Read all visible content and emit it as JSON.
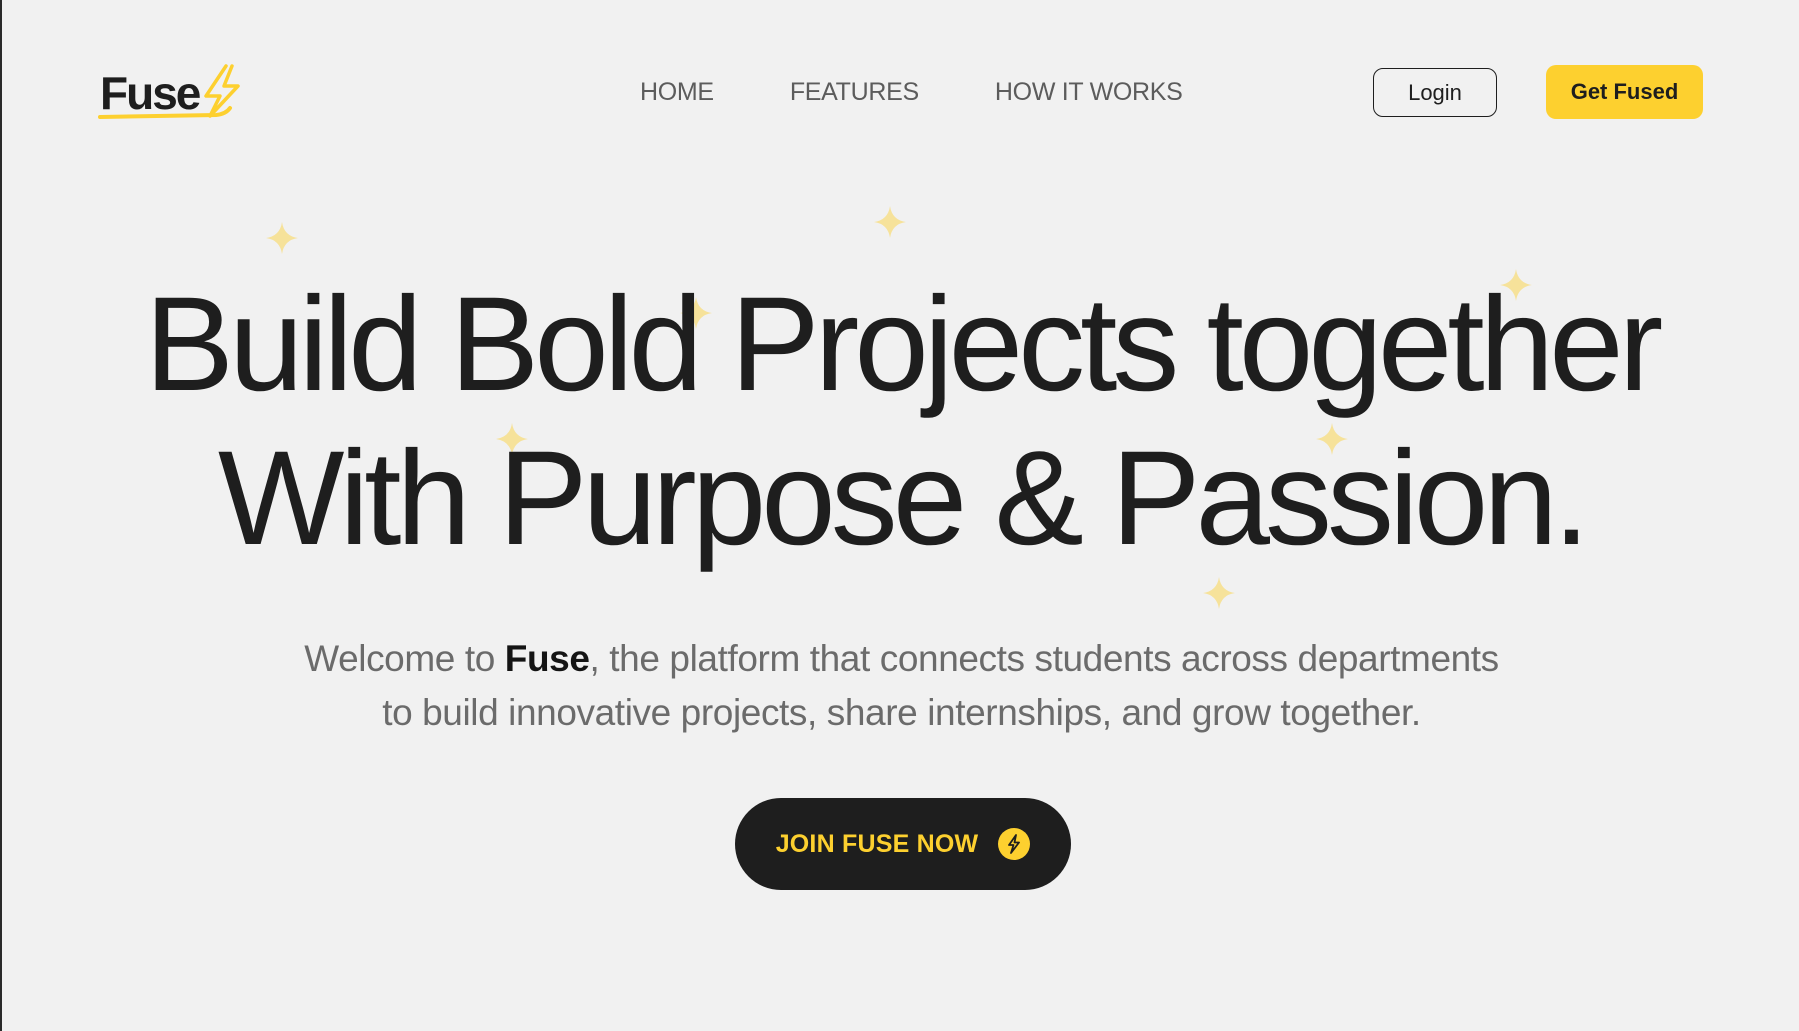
{
  "brand": {
    "name": "Fuse",
    "accent_color": "#fdd02f",
    "logo_icon": "lightning-bolt-icon"
  },
  "nav": {
    "links": [
      {
        "label": "HOME"
      },
      {
        "label": "FEATURES"
      },
      {
        "label": "HOW IT WORKS"
      }
    ],
    "login_label": "Login",
    "get_fused_label": "Get Fused"
  },
  "hero": {
    "headline_line1": "Build Bold Projects together",
    "headline_line2": "With Purpose & Passion.",
    "subtitle_prefix": "Welcome to ",
    "subtitle_brand": "Fuse",
    "subtitle_line1_rest": ", the platform that connects students across departments",
    "subtitle_line2": "to build innovative projects, share internships, and grow together.",
    "cta_label": "JOIN FUSE NOW",
    "cta_icon": "lightning-circle-icon",
    "decoration_icon": "sparkle-icon"
  },
  "colors": {
    "background": "#f1f1f1",
    "text": "#1e1e1e",
    "muted_text": "#6b6b6b",
    "sparkle": "#f6e29a"
  }
}
